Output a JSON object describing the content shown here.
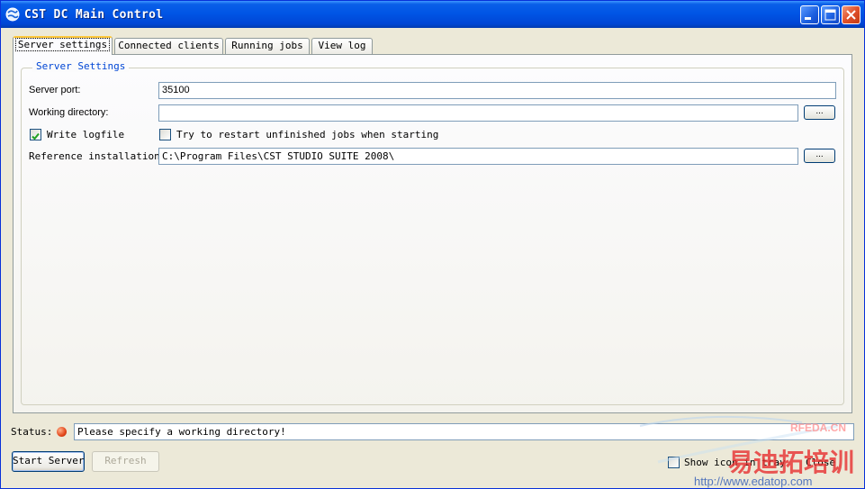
{
  "window": {
    "title": "CST DC Main Control"
  },
  "tabs": [
    {
      "label": "Server settings",
      "active": true
    },
    {
      "label": "Connected clients",
      "active": false
    },
    {
      "label": "Running jobs",
      "active": false
    },
    {
      "label": "View log",
      "active": false
    }
  ],
  "server_settings": {
    "group_title": "Server Settings",
    "port_label": "Server port:",
    "port_value": "35100",
    "workdir_label": "Working directory:",
    "workdir_value": "",
    "browse_label": "...",
    "write_logfile_label": "Write logfile",
    "write_logfile_checked": true,
    "restart_jobs_label": "Try to restart unfinished jobs when starting",
    "restart_jobs_checked": false,
    "ref_install_label": "Reference installation:",
    "ref_install_value": "C:\\Program Files\\CST STUDIO SUITE 2008\\"
  },
  "status": {
    "label": "Status:",
    "message": "Please specify a working directory!",
    "indicator_color": "#e2461a"
  },
  "footer": {
    "start_server_label": "Start Server",
    "refresh_label": "Refresh",
    "show_icon_tray_label": "Show icon in tray",
    "close_label": "Close"
  },
  "watermark": {
    "line1": "RFEDA.CN",
    "line2": "易迪拓培训",
    "line3": "http://www.edatop.com"
  },
  "colors": {
    "titlebar": "#0055e5",
    "group_title": "#0046d5",
    "active_tab_accent": "#ffc83c",
    "dialog_bg": "#ece9d8"
  }
}
